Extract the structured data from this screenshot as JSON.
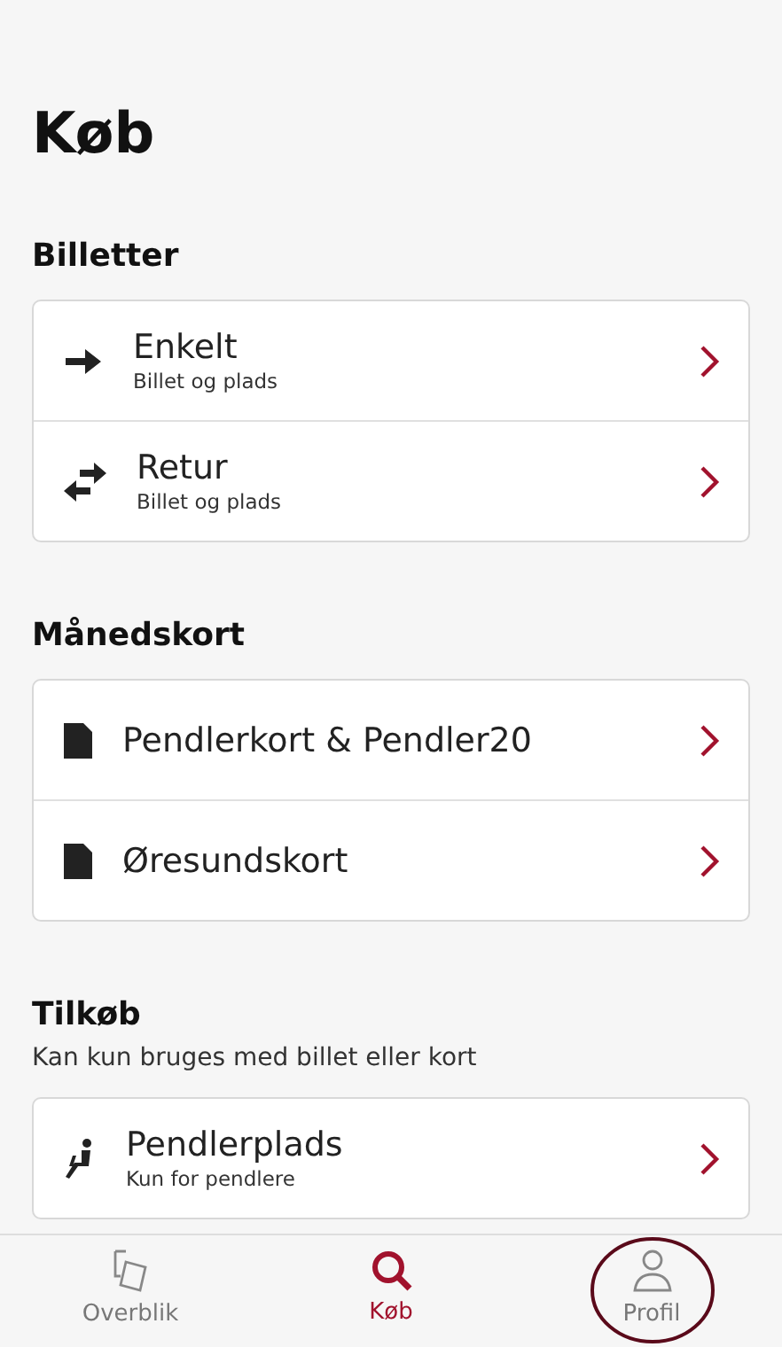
{
  "title": "Køb",
  "sections": [
    {
      "heading": "Billetter",
      "items": [
        {
          "title": "Enkelt",
          "subtitle": "Billet og plads"
        },
        {
          "title": "Retur",
          "subtitle": "Billet og plads"
        }
      ]
    },
    {
      "heading": "Månedskort",
      "items": [
        {
          "title": "Pendlerkort & Pendler20"
        },
        {
          "title": "Øresundskort"
        }
      ]
    },
    {
      "heading": "Tilkøb",
      "description": "Kan kun bruges med billet eller kort",
      "items": [
        {
          "title": "Pendlerplads",
          "subtitle": "Kun for pendlere"
        }
      ]
    }
  ],
  "tabs": [
    {
      "label": "Overblik",
      "selected": false,
      "circled": false
    },
    {
      "label": "Køb",
      "selected": true,
      "circled": false
    },
    {
      "label": "Profil",
      "selected": false,
      "circled": true
    }
  ]
}
